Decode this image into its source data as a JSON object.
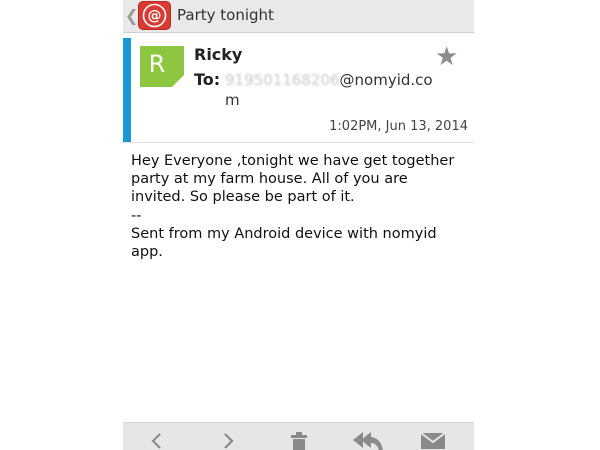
{
  "header": {
    "title": "Party tonight",
    "app_icon": "at-sign-icon",
    "back_icon": "chevron-left-icon"
  },
  "message": {
    "sender": "Ricky",
    "avatar_letter": "R",
    "avatar_color": "#8dc63f",
    "to_label": "To:",
    "to_redacted": "919501168206",
    "to_domain": "@nomyid.com",
    "timestamp": "1:02PM, Jun 13, 2014",
    "star_icon": "star-icon",
    "body_lines": [
      "Hey Everyone ,tonight we have get together party at my farm house. All of you are invited. So please be part of it.",
      "--",
      "Sent from my Android device with nomyid app."
    ]
  },
  "toolbar": {
    "icons": [
      "previous-icon",
      "next-icon",
      "delete-icon",
      "reply-all-icon",
      "mail-icon"
    ]
  },
  "colors": {
    "accent": "#1a98d5",
    "app_icon": "#d83b33"
  }
}
